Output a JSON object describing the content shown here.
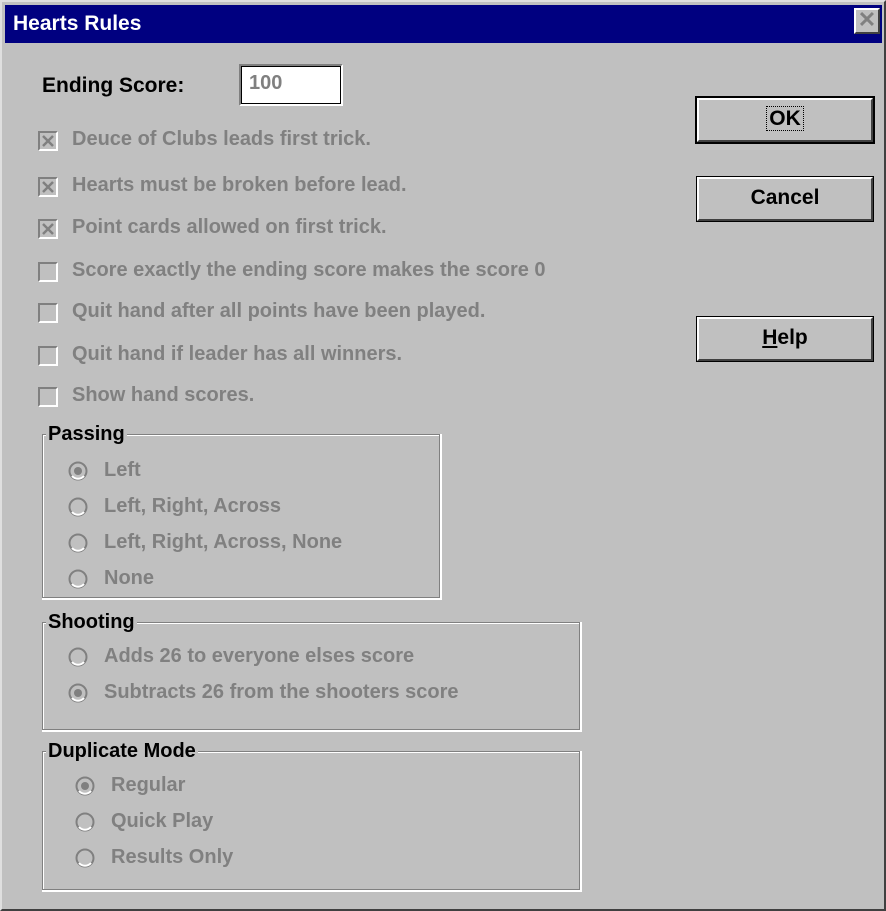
{
  "window": {
    "title": "Hearts Rules",
    "close_glyph": "✕"
  },
  "ending_score": {
    "label": "Ending Score:",
    "value": "100"
  },
  "options": [
    {
      "label": "Deuce of Clubs leads first trick.",
      "checked": true
    },
    {
      "label": "Hearts must be broken before lead.",
      "checked": true
    },
    {
      "label": "Point cards allowed on first trick.",
      "checked": true
    },
    {
      "label": "Score exactly the ending score makes the score 0",
      "checked": false
    },
    {
      "label": "Quit hand after all points have been played.",
      "checked": false
    },
    {
      "label": "Quit hand if leader has all winners.",
      "checked": false
    },
    {
      "label": "Show hand scores.",
      "checked": false
    }
  ],
  "passing": {
    "title": "Passing",
    "options": [
      "Left",
      "Left, Right, Across",
      "Left, Right, Across, None",
      "None"
    ],
    "selected": 0
  },
  "shooting": {
    "title": "Shooting",
    "options": [
      "Adds 26 to everyone elses score",
      "Subtracts 26 from the shooters score"
    ],
    "selected": 1
  },
  "duplicate": {
    "title": "Duplicate Mode",
    "options": [
      "Regular",
      "Quick Play",
      "Results Only"
    ],
    "selected": 0
  },
  "buttons": {
    "ok": {
      "label": "OK"
    },
    "cancel": {
      "label": "Cancel"
    },
    "help_mnemonic": "H",
    "help_rest": "elp"
  },
  "colors": {
    "titlebar": "#000080",
    "face": "#c0c0c0",
    "disabled_text": "#808080"
  }
}
